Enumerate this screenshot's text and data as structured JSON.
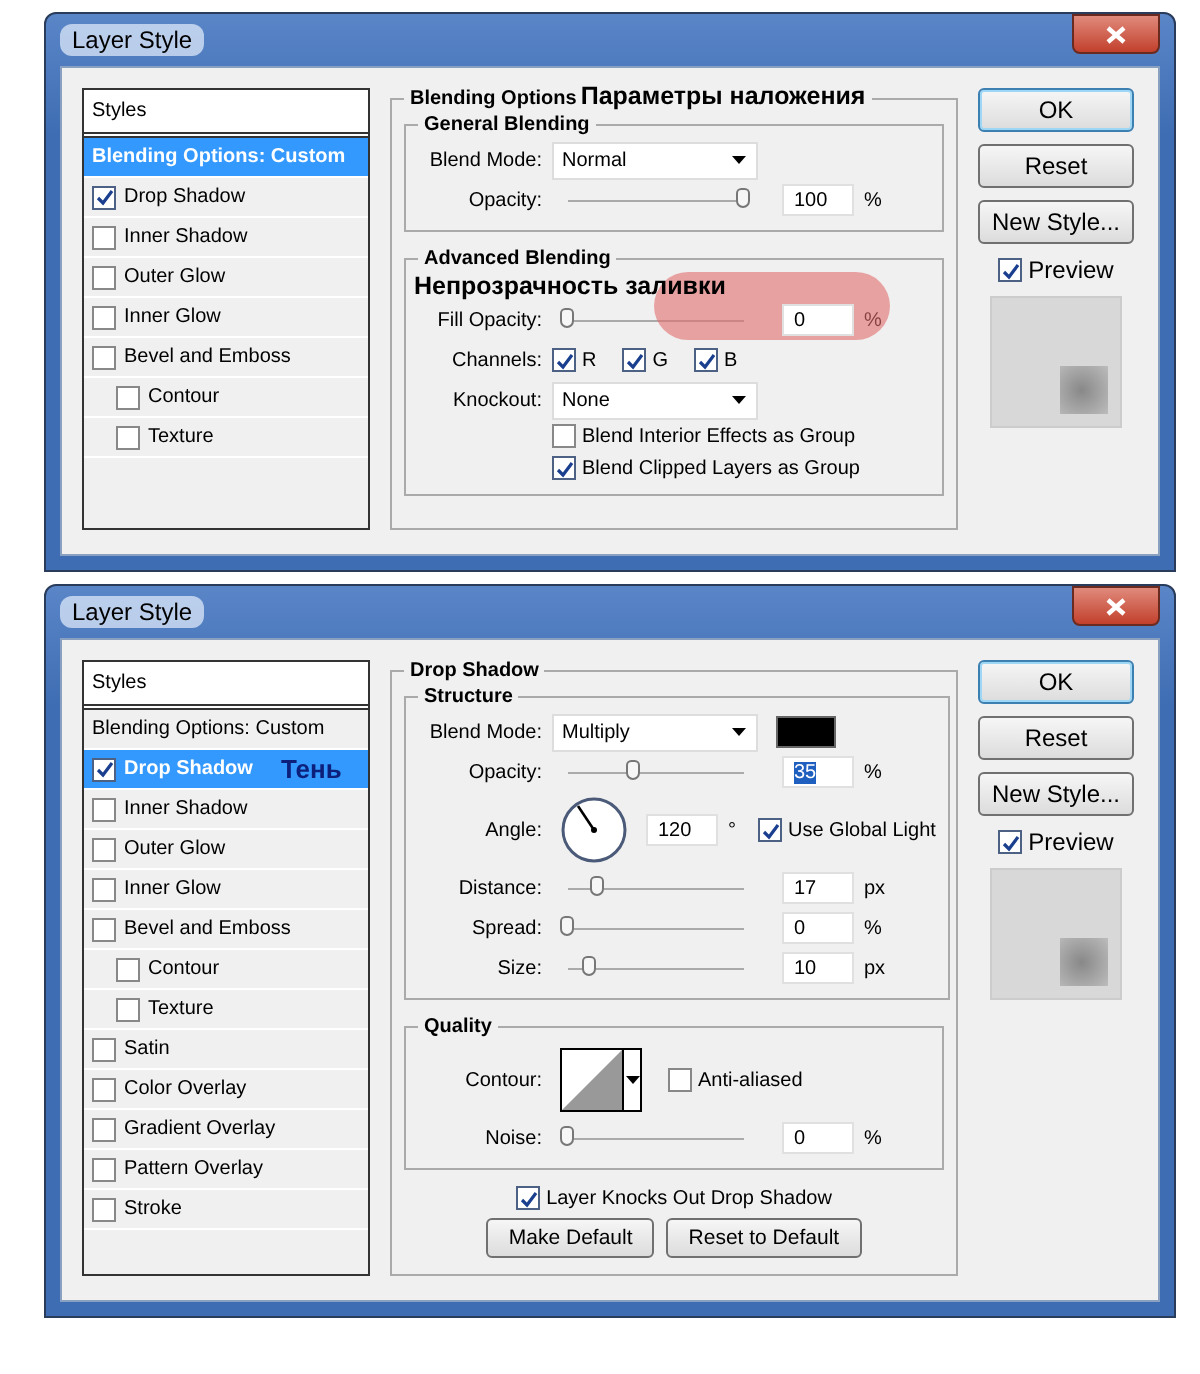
{
  "dialogs": [
    {
      "title": "Layer Style",
      "sidebar": {
        "header": "Styles",
        "items": [
          {
            "kind": "plain",
            "label": "Blending Options: Custom",
            "selected": true
          },
          {
            "kind": "checkbox",
            "label": "Drop Shadow",
            "checked": true,
            "selected": false
          },
          {
            "kind": "checkbox",
            "label": "Inner Shadow",
            "checked": false,
            "selected": false
          },
          {
            "kind": "checkbox",
            "label": "Outer Glow",
            "checked": false,
            "selected": false
          },
          {
            "kind": "checkbox",
            "label": "Inner Glow",
            "checked": false,
            "selected": false
          },
          {
            "kind": "checkbox",
            "label": "Bevel and Emboss",
            "checked": false,
            "selected": false,
            "children": [
              {
                "kind": "checkbox",
                "label": "Contour",
                "checked": false,
                "selected": false
              },
              {
                "kind": "checkbox",
                "label": "Texture",
                "checked": false,
                "selected": false
              }
            ]
          }
        ]
      },
      "section": {
        "title": "Blending Options",
        "annotation": "Параметры наложения",
        "groups": [
          {
            "title": "General Blending",
            "rows": [
              {
                "kind": "dropdown",
                "label": "Blend Mode:",
                "value": "Normal"
              },
              {
                "kind": "slider",
                "label": "Opacity:",
                "level": 1,
                "value": "100",
                "unit": "%"
              }
            ]
          },
          {
            "title": "Advanced Blending",
            "rows": [
              {
                "kind": "slider",
                "label": "Fill Opacity:",
                "level": 0,
                "value": "0",
                "unit": "%",
                "annotation": "Непрозрачность заливки",
                "highlighted": true
              },
              {
                "kind": "channels",
                "label": "Channels:",
                "options": [
                  {
                    "label": "R",
                    "checked": true
                  },
                  {
                    "label": "G",
                    "checked": true
                  },
                  {
                    "label": "B",
                    "checked": true
                  }
                ]
              },
              {
                "kind": "dropdown",
                "label": "Knockout:",
                "value": "None"
              },
              {
                "kind": "checkbox",
                "label": "Blend Interior Effects as Group",
                "checked": false
              },
              {
                "kind": "checkbox",
                "label": "Blend Clipped Layers as Group",
                "checked": true
              }
            ]
          }
        ]
      },
      "buttons": [
        {
          "label": "OK",
          "default": true
        },
        {
          "label": "Reset",
          "default": false
        },
        {
          "label": "New Style...",
          "default": false
        }
      ],
      "preview": {
        "label": "Preview",
        "checked": true
      }
    },
    {
      "title": "Layer Style",
      "sidebar": {
        "header": "Styles",
        "items": [
          {
            "kind": "plain",
            "label": "Blending Options: Custom",
            "selected": false
          },
          {
            "kind": "checkbox",
            "label": "Drop Shadow",
            "checked": true,
            "selected": true,
            "annotation": "Тень"
          },
          {
            "kind": "checkbox",
            "label": "Inner Shadow",
            "checked": false,
            "selected": false
          },
          {
            "kind": "checkbox",
            "label": "Outer Glow",
            "checked": false,
            "selected": false
          },
          {
            "kind": "checkbox",
            "label": "Inner Glow",
            "checked": false,
            "selected": false
          },
          {
            "kind": "checkbox",
            "label": "Bevel and Emboss",
            "checked": false,
            "selected": false,
            "children": [
              {
                "kind": "checkbox",
                "label": "Contour",
                "checked": false,
                "selected": false
              },
              {
                "kind": "checkbox",
                "label": "Texture",
                "checked": false,
                "selected": false
              }
            ]
          },
          {
            "kind": "checkbox",
            "label": "Satin",
            "checked": false,
            "selected": false
          },
          {
            "kind": "checkbox",
            "label": "Color Overlay",
            "checked": false,
            "selected": false
          },
          {
            "kind": "checkbox",
            "label": "Gradient Overlay",
            "checked": false,
            "selected": false
          },
          {
            "kind": "checkbox",
            "label": "Pattern Overlay",
            "checked": false,
            "selected": false
          },
          {
            "kind": "checkbox",
            "label": "Stroke",
            "checked": false,
            "selected": false
          }
        ]
      },
      "section": {
        "title": "Drop Shadow",
        "groups": [
          {
            "title": "Structure",
            "rows": [
              {
                "kind": "dropdown",
                "label": "Blend Mode:",
                "value": "Multiply",
                "color": "#000000"
              },
              {
                "kind": "slider",
                "label": "Opacity:",
                "level": 0.38,
                "value": "35",
                "unit": "%",
                "selected": true
              },
              {
                "kind": "angle",
                "label": "Angle:",
                "value": "120",
                "unit": "°",
                "option": {
                  "label": "Use Global Light",
                  "checked": true
                }
              },
              {
                "kind": "slider",
                "label": "Distance:",
                "level": 0.17,
                "value": "17",
                "unit": "px"
              },
              {
                "kind": "slider",
                "label": "Spread:",
                "level": 0,
                "value": "0",
                "unit": "%"
              },
              {
                "kind": "slider",
                "label": "Size:",
                "level": 0.12,
                "value": "10",
                "unit": "px"
              }
            ]
          },
          {
            "title": "Quality",
            "rows": [
              {
                "kind": "contour",
                "label": "Contour:",
                "option": {
                  "label": "Anti-aliased",
                  "checked": false
                }
              },
              {
                "kind": "slider",
                "label": "Noise:",
                "level": 0,
                "value": "0",
                "unit": "%"
              }
            ]
          }
        ],
        "footer": {
          "checkbox": {
            "label": "Layer Knocks Out Drop Shadow",
            "checked": true
          },
          "buttons": [
            "Make Default",
            "Reset to Default"
          ]
        }
      },
      "buttons": [
        {
          "label": "OK",
          "default": true
        },
        {
          "label": "Reset",
          "default": false
        },
        {
          "label": "New Style...",
          "default": false
        }
      ],
      "preview": {
        "label": "Preview",
        "checked": true
      }
    }
  ]
}
